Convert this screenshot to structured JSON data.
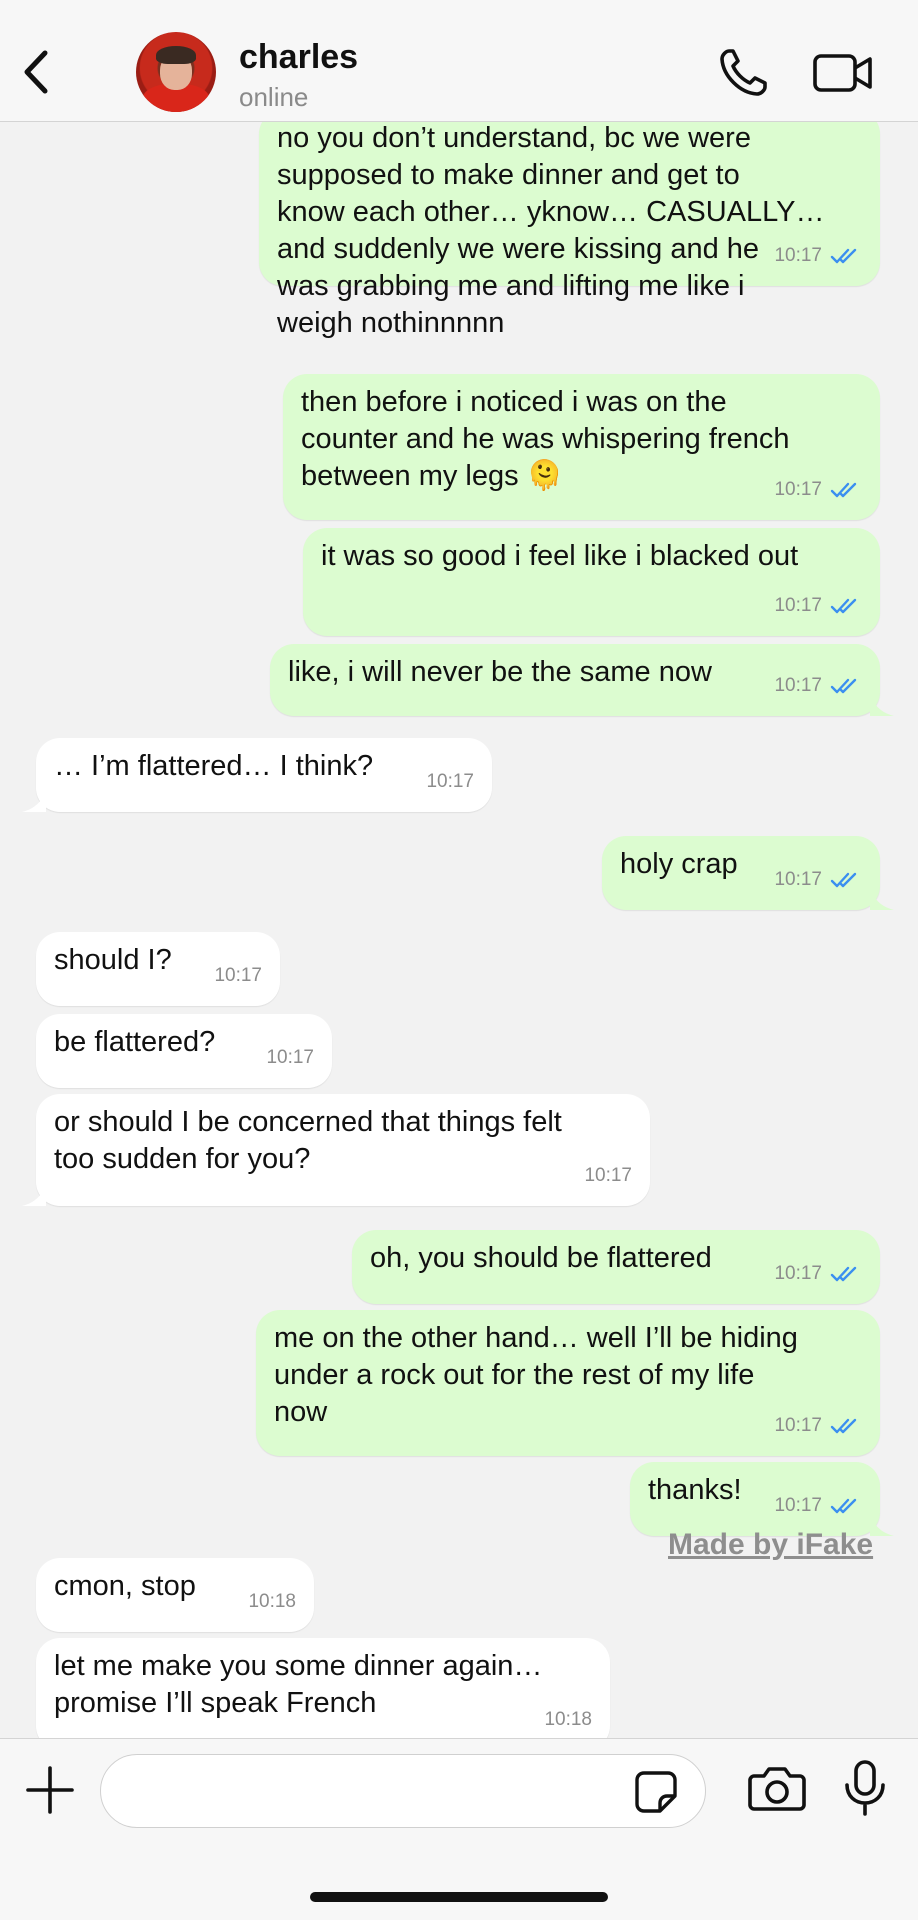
{
  "header": {
    "name": "charles",
    "status": "online"
  },
  "messages": [
    {
      "dir": "out",
      "text": "no you don’t understand, bc we were\nsupposed to make dinner and get to\nknow each other… yknow… CASUALLY…\nand suddenly we were kissing and he\nwas grabbing me and lifting me like i\nweigh nothinnnnn",
      "time": "10:17",
      "read": true
    },
    {
      "dir": "out",
      "text": "then before i noticed i was on the\ncounter and he was whispering french\nbetween my legs 🫠",
      "time": "10:17",
      "read": true
    },
    {
      "dir": "out",
      "text": "it was so good i feel like i blacked out",
      "time": "10:17",
      "read": true
    },
    {
      "dir": "out",
      "text": "like, i will never be the same now",
      "time": "10:17",
      "read": true
    },
    {
      "dir": "in",
      "text": "… I’m flattered… I think?",
      "time": "10:17"
    },
    {
      "dir": "out",
      "text": "holy crap",
      "time": "10:17",
      "read": true
    },
    {
      "dir": "in",
      "text": "should I?",
      "time": "10:17"
    },
    {
      "dir": "in",
      "text": "be flattered?",
      "time": "10:17"
    },
    {
      "dir": "in",
      "text": "or should I be concerned that things felt\ntoo sudden for you?",
      "time": "10:17"
    },
    {
      "dir": "out",
      "text": "oh, you should be flattered",
      "time": "10:17",
      "read": true
    },
    {
      "dir": "out",
      "text": "me on the other hand… well I’ll be hiding\nunder a rock out for the rest of my life\nnow",
      "time": "10:17",
      "read": true
    },
    {
      "dir": "out",
      "text": "thanks!",
      "time": "10:17",
      "read": true
    },
    {
      "dir": "in",
      "text": "cmon, stop",
      "time": "10:18"
    },
    {
      "dir": "in",
      "text": "let me make you some dinner again…\npromise I’ll speak French",
      "time": "10:18"
    }
  ],
  "watermark": "Made by iFake",
  "colors": {
    "outgoing_bubble": "#dcfcd0",
    "incoming_bubble": "#ffffff",
    "read_ticks": "#3b8ff0",
    "background": "#f2f2f2"
  },
  "icons": [
    "back-arrow-icon",
    "phone-icon",
    "video-camera-icon",
    "plus-icon",
    "sticker-icon",
    "camera-icon",
    "microphone-icon",
    "double-check-icon"
  ]
}
